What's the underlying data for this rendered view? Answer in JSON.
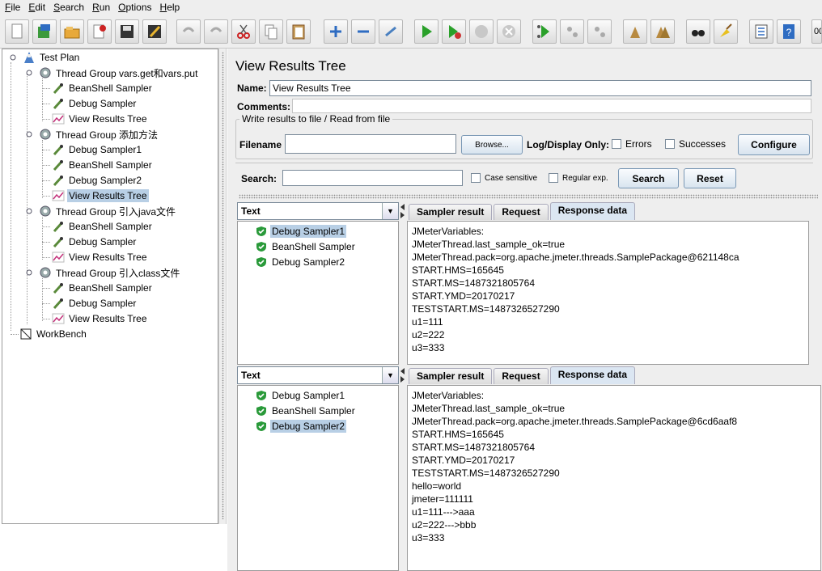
{
  "menu": [
    "File",
    "Edit",
    "Search",
    "Run",
    "Options",
    "Help"
  ],
  "toolbar": {
    "icons": [
      "new-icon",
      "templates-icon",
      "open-icon",
      "close-icon",
      "save-icon",
      "save-as-icon",
      "undo-icon",
      "redo-icon",
      "cut-icon",
      "copy-icon",
      "paste-icon",
      "expand-icon",
      "collapse-icon",
      "toggle-icon",
      "start-icon",
      "start-no-pause-icon",
      "stop-icon",
      "shutdown-icon",
      "remote-start-icon",
      "remote-stop-icon",
      "remote-shutdown-icon",
      "clear-icon",
      "clear-all-icon",
      "search-icon",
      "reset-search-icon",
      "function-helper-icon",
      "help-icon"
    ],
    "counter": "00"
  },
  "tree": {
    "root": "Test Plan",
    "groups": [
      {
        "label": "Thread Group  vars.get和vars.put",
        "children": [
          "BeanShell Sampler",
          "Debug Sampler",
          "View Results Tree"
        ]
      },
      {
        "label": "Thread Group  添加方法",
        "children": [
          "Debug Sampler1",
          "BeanShell Sampler",
          "Debug Sampler2",
          "View Results Tree"
        ]
      },
      {
        "label": "Thread Group 引入java文件",
        "children": [
          "BeanShell Sampler",
          "Debug Sampler",
          "View Results Tree"
        ]
      },
      {
        "label": "Thread Group 引入class文件",
        "children": [
          "BeanShell Sampler",
          "Debug Sampler",
          "View Results Tree"
        ]
      }
    ],
    "workbench": "WorkBench"
  },
  "panel": {
    "title": "View Results Tree",
    "name_label": "Name:",
    "name_value": "View Results Tree",
    "comments_label": "Comments:",
    "write_legend": "Write results to file / Read from file",
    "filename_label": "Filename",
    "filename_value": "",
    "browse_label": "Browse...",
    "log_only_label": "Log/Display Only:",
    "errors_label": "Errors",
    "successes_label": "Successes",
    "configure_label": "Configure",
    "search_label": "Search:",
    "search_value": "",
    "case_sensitive_label": "Case sensitive",
    "regex_label": "Regular exp.",
    "search_button": "Search",
    "reset_button": "Reset"
  },
  "results": [
    {
      "renderer": "Text",
      "samples": [
        "Debug Sampler1",
        "BeanShell Sampler",
        "Debug Sampler2"
      ],
      "tabs": [
        "Sampler result",
        "Request",
        "Response data"
      ],
      "response": "JMeterVariables:\nJMeterThread.last_sample_ok=true\nJMeterThread.pack=org.apache.jmeter.threads.SamplePackage@621148ca\nSTART.HMS=165645\nSTART.MS=1487321805764\nSTART.YMD=20170217\nTESTSTART.MS=1487326527290\nu1=111\nu2=222\nu3=333"
    },
    {
      "renderer": "Text",
      "samples": [
        "Debug Sampler1",
        "BeanShell Sampler",
        "Debug Sampler2"
      ],
      "tabs": [
        "Sampler result",
        "Request",
        "Response data"
      ],
      "response": "JMeterVariables:\nJMeterThread.last_sample_ok=true\nJMeterThread.pack=org.apache.jmeter.threads.SamplePackage@6cd6aaf8\nSTART.HMS=165645\nSTART.MS=1487321805764\nSTART.YMD=20170217\nTESTSTART.MS=1487326527290\nhello=world\njmeter=111111\nu1=111--->aaa\nu2=222--->bbb\nu3=333"
    }
  ]
}
